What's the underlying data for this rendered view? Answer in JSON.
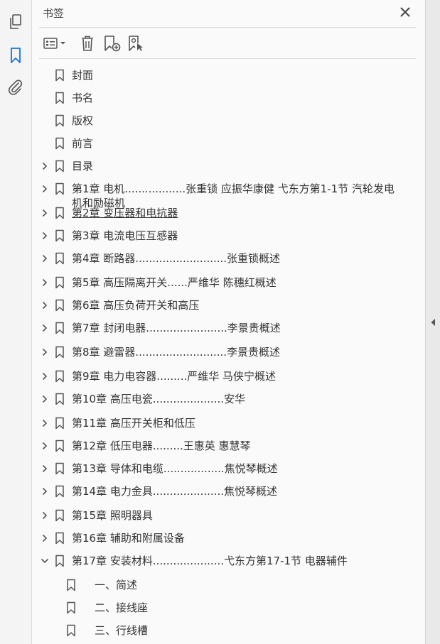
{
  "panel": {
    "title": "书签",
    "close_icon": "close-icon"
  },
  "rail": {
    "icons": [
      "pages-icon",
      "bookmark-icon",
      "attachment-icon"
    ],
    "active": "bookmark-icon",
    "accent_color": "#1473e6"
  },
  "toolbar": {
    "icons": [
      "options-menu-icon",
      "delete-icon",
      "new-bookmark-icon",
      "bookmark-properties-icon"
    ]
  },
  "bookmarks": [
    {
      "label": "封面",
      "expandable": false,
      "level": 1
    },
    {
      "label": "书名",
      "expandable": false,
      "level": 1
    },
    {
      "label": "版权",
      "expandable": false,
      "level": 1
    },
    {
      "label": "前言",
      "expandable": false,
      "level": 1
    },
    {
      "label": "目录",
      "expandable": true,
      "expanded": false,
      "level": 1
    },
    {
      "label": "第1章  电机..................张重锁    应振华康健    弋东方第1-1节  汽轮发电机和励磁机",
      "expandable": true,
      "expanded": false,
      "level": 1
    },
    {
      "label": "第2章  变压器和电抗器",
      "expandable": true,
      "expanded": false,
      "level": 1,
      "underlined": true
    },
    {
      "label": "第3章  电流电压互感器",
      "expandable": true,
      "expanded": false,
      "level": 1
    },
    {
      "label": "第4章    断路器...........................张重锁概述",
      "expandable": true,
      "expanded": false,
      "level": 1
    },
    {
      "label": "第5章  高压隔离开关......严维华  陈穗红概述",
      "expandable": true,
      "expanded": false,
      "level": 1
    },
    {
      "label": "第6章  高压负荷开关和高压",
      "expandable": true,
      "expanded": false,
      "level": 1
    },
    {
      "label": "第7章  封闭电器........................李景贵概述",
      "expandable": true,
      "expanded": false,
      "level": 1
    },
    {
      "label": "第8章  避雷器...........................李景贵概述",
      "expandable": true,
      "expanded": false,
      "level": 1
    },
    {
      "label": "第9章    电力电容器.........严维华    马侠宁概述",
      "expandable": true,
      "expanded": false,
      "level": 1
    },
    {
      "label": "第10章    高压电瓷.....................安华",
      "expandable": true,
      "expanded": false,
      "level": 1
    },
    {
      "label": "第11章    高压开关柜和低压",
      "expandable": true,
      "expanded": false,
      "level": 1
    },
    {
      "label": "第12章 低压电器.........王惠英  惠慧琴",
      "expandable": true,
      "expanded": false,
      "level": 1
    },
    {
      "label": "第13章  导体和电缆..................焦悦琴概述",
      "expandable": true,
      "expanded": false,
      "level": 1
    },
    {
      "label": "第14章  电力金具.....................焦悦琴概述",
      "expandable": true,
      "expanded": false,
      "level": 1
    },
    {
      "label": "第15章  照明器具",
      "expandable": true,
      "expanded": false,
      "level": 1
    },
    {
      "label": "第16章  辅助和附属设备",
      "expandable": true,
      "expanded": false,
      "level": 1
    },
    {
      "label": "第17章  安装材料.....................弋东方第17-1节  电器辅件",
      "expandable": true,
      "expanded": true,
      "level": 1
    },
    {
      "label": "一、简述",
      "expandable": false,
      "level": 2
    },
    {
      "label": "二、接线座",
      "expandable": false,
      "level": 2
    },
    {
      "label": "三、行线槽",
      "expandable": false,
      "level": 2
    }
  ]
}
